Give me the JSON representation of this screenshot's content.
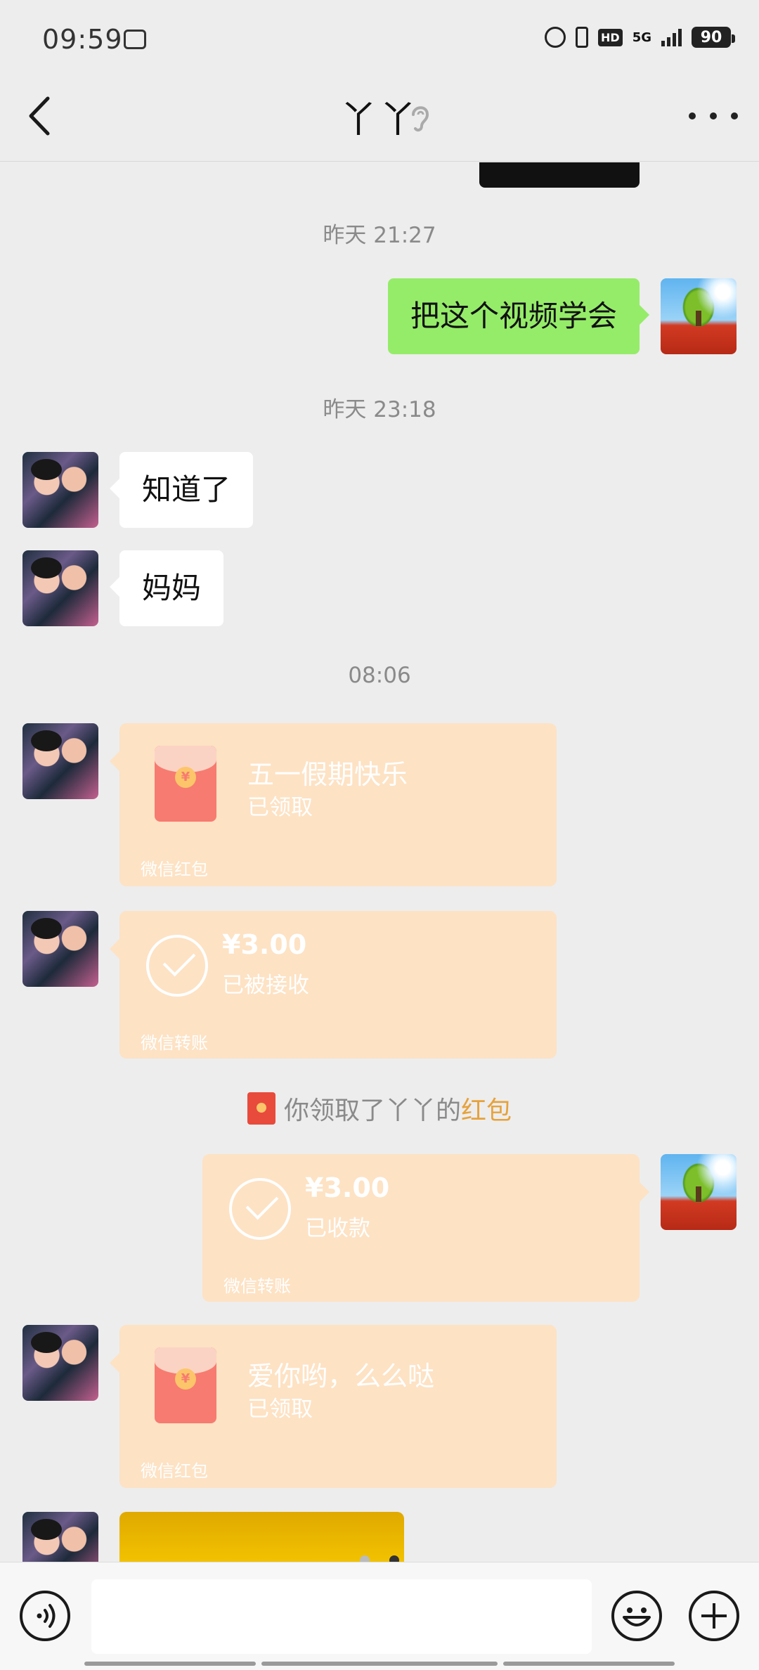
{
  "status_bar": {
    "time": "09:59",
    "battery": "90",
    "network": "5G",
    "hd": "HD"
  },
  "header": {
    "title": "丫丫"
  },
  "chat": {
    "timestamps": [
      "昨天 21:27",
      "昨天 23:18",
      "08:06"
    ],
    "sent_text": "把这个视频学会",
    "received_1": "知道了",
    "received_2": "妈妈",
    "red_packet_1": {
      "title": "五一假期快乐",
      "status": "已领取",
      "footer": "微信红包"
    },
    "transfer_1": {
      "amount": "¥3.00",
      "status": "已被接收",
      "footer": "微信转账"
    },
    "system_msg": {
      "prefix": "你领取了丫丫的",
      "link": "红包"
    },
    "transfer_2": {
      "amount": "¥3.00",
      "status": "已收款",
      "footer": "微信转账"
    },
    "red_packet_2": {
      "title": "爱你哟，么么哒",
      "status": "已领取",
      "footer": "微信红包"
    }
  },
  "input_bar": {
    "placeholder": ""
  },
  "colors": {
    "bubble_green": "#95ec69",
    "card_orange": "#fde2c4",
    "link_orange": "#e6a23c"
  }
}
